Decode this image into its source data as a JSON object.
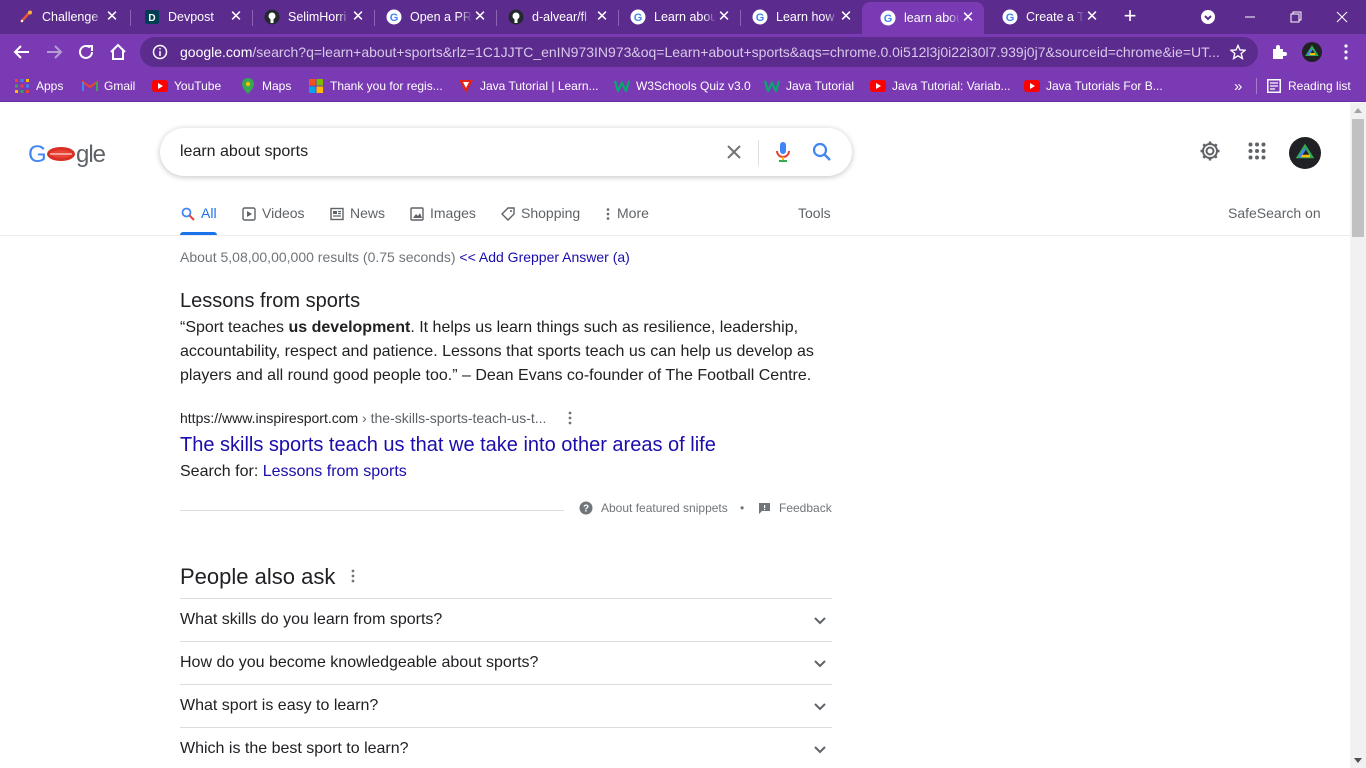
{
  "browser": {
    "tabs": [
      {
        "title": "Challenge",
        "icon": "challenge-favicon",
        "x": 0,
        "w": 122
      },
      {
        "title": "Devpost",
        "icon": "devpost-favicon",
        "x": 0,
        "w": 0
      },
      {
        "title": "SelimHorri",
        "icon": "github-favicon",
        "x": 0,
        "w": 0
      },
      {
        "title": "Open a PR",
        "icon": "google-favicon",
        "x": 0,
        "w": 0
      },
      {
        "title": "d-alvear/fl",
        "icon": "github-favicon",
        "x": 0,
        "w": 0
      },
      {
        "title": "Learn abou",
        "icon": "google-favicon",
        "x": 0,
        "w": 0
      },
      {
        "title": "Learn how",
        "icon": "google-favicon",
        "x": 0,
        "w": 0
      },
      {
        "title": "learn abou",
        "icon": "google-favicon",
        "x": 0,
        "w": 0
      },
      {
        "title": "Create a Tr",
        "icon": "google-favicon",
        "x": 0,
        "w": 0
      }
    ],
    "new_tab": "+",
    "url_host": "google.com",
    "url_path": "/search?q=learn+about+sports&rlz=1C1JJTC_enIN973IN973&oq=Learn+about+sports&aqs=chrome.0.0i512l3j0i22i30l7.939j0j7&sourceid=chrome&ie=UT...",
    "bookmarks": [
      {
        "label": "Apps",
        "icon": "apps-grid-icon"
      },
      {
        "label": "Gmail",
        "icon": "gmail-icon"
      },
      {
        "label": "YouTube",
        "icon": "youtube-icon"
      },
      {
        "label": "Maps",
        "icon": "maps-icon"
      },
      {
        "label": "Thank you for regis...",
        "icon": "microsoft-icon"
      },
      {
        "label": "Java Tutorial | Learn...",
        "icon": "javatpoint-icon"
      },
      {
        "label": "W3Schools Quiz v3.0",
        "icon": "w3schools-icon"
      },
      {
        "label": "Java Tutorial",
        "icon": "w3schools-icon"
      },
      {
        "label": "Java Tutorial: Variab...",
        "icon": "youtube-icon"
      },
      {
        "label": "Java Tutorials For B...",
        "icon": "youtube-icon"
      }
    ],
    "bookmarks_overflow": "»",
    "reading_list": "Reading list"
  },
  "search": {
    "query": "learn about sports",
    "tabs": [
      {
        "label": "All",
        "icon": "search-icon",
        "active": true
      },
      {
        "label": "Videos",
        "icon": "video-icon"
      },
      {
        "label": "News",
        "icon": "news-icon"
      },
      {
        "label": "Images",
        "icon": "image-icon"
      },
      {
        "label": "Shopping",
        "icon": "tag-icon"
      },
      {
        "label": "More",
        "icon": "more-vert-icon"
      }
    ],
    "tools": "Tools",
    "safesearch": "SafeSearch on",
    "stats": "About 5,08,00,00,000 results (0.75 seconds)",
    "grepper": "<< Add Grepper Answer (a)"
  },
  "snippet": {
    "title": "Lessons from sports",
    "text_before": "“Sport teaches ",
    "text_bold": "us development",
    "text_after": ". It helps us learn things such as resilience, leadership, accountability, respect and patience. Lessons that sports teach us can help us develop as players and all round good people too.” – Dean Evans co-founder of The Football Centre.",
    "cite_host": "https://www.inspiresport.com",
    "cite_path": " › the-skills-sports-teach-us-t...",
    "link_title": "The skills sports teach us that we take into other areas of life",
    "search_for_label": "Search for: ",
    "search_for_link": "Lessons from sports",
    "about": "About featured snippets",
    "dot": "•",
    "feedback": "Feedback"
  },
  "paa": {
    "title": "People also ask",
    "questions": [
      "What skills do you learn from sports?",
      "How do you become knowledgeable about sports?",
      "What sport is easy to learn?",
      "Which is the best sport to learn?"
    ]
  },
  "colors": {
    "tab_strip": "#5b2c8e",
    "toolbar": "#7a3ab3",
    "link": "#1a0dab",
    "accent": "#1a73e8"
  }
}
